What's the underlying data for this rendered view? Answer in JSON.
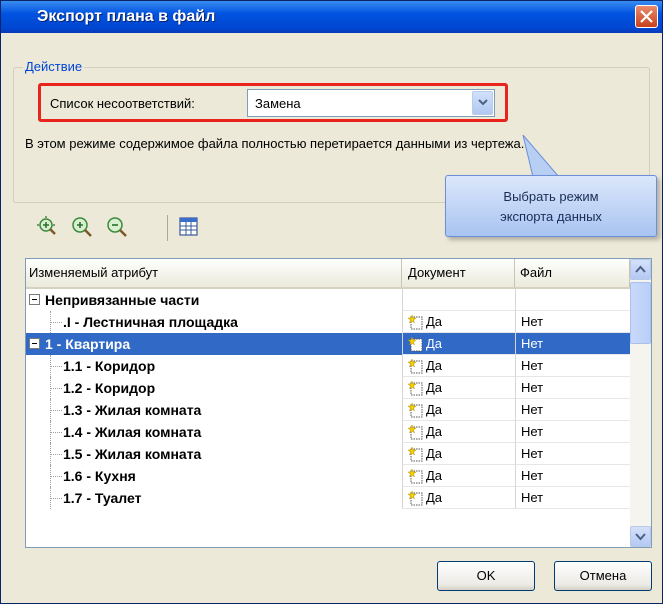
{
  "window": {
    "title": "Экспорт плана в файл"
  },
  "action_group": {
    "legend": "Действие",
    "mismatch_label": "Список несоответствий:",
    "mismatch_value": "Замена",
    "description": "В этом режиме содержимое файла полностью перетирается данными из чертежа."
  },
  "callout": {
    "line1": "Выбрать режим",
    "line2": "экспорта данных"
  },
  "toolbar": {
    "icons": [
      "expand-all-icon",
      "zoom-in-icon",
      "zoom-out-icon",
      "table-icon"
    ]
  },
  "grid": {
    "headers": [
      "Изменяемый атрибут",
      "Документ",
      "Файл"
    ],
    "rows": [
      {
        "name": "Непривязанные части",
        "doc": "",
        "file": "",
        "level": 0,
        "expander": true,
        "selected": false
      },
      {
        "name": ".I - Лестничная площадка",
        "doc": "Да",
        "file": "Нет",
        "level": 1,
        "expander": false,
        "selected": false
      },
      {
        "name": "1 - Квартира",
        "doc": "Да",
        "file": "Нет",
        "level": 0,
        "expander": true,
        "selected": true
      },
      {
        "name": "1.1 - Коридор",
        "doc": "Да",
        "file": "Нет",
        "level": 1,
        "expander": false,
        "selected": false
      },
      {
        "name": "1.2 - Коридор",
        "doc": "Да",
        "file": "Нет",
        "level": 1,
        "expander": false,
        "selected": false
      },
      {
        "name": "1.3 - Жилая комната",
        "doc": "Да",
        "file": "Нет",
        "level": 1,
        "expander": false,
        "selected": false
      },
      {
        "name": "1.4 - Жилая комната",
        "doc": "Да",
        "file": "Нет",
        "level": 1,
        "expander": false,
        "selected": false
      },
      {
        "name": "1.5 - Жилая комната",
        "doc": "Да",
        "file": "Нет",
        "level": 1,
        "expander": false,
        "selected": false
      },
      {
        "name": "1.6 - Кухня",
        "doc": "Да",
        "file": "Нет",
        "level": 1,
        "expander": false,
        "selected": false
      },
      {
        "name": "1.7 - Туалет",
        "doc": "Да",
        "file": "Нет",
        "level": 1,
        "expander": false,
        "selected": false
      }
    ]
  },
  "buttons": {
    "ok": "OK",
    "cancel": "Отмена"
  },
  "colors": {
    "title_bar": "#0053e0",
    "selection": "#3169c6",
    "highlight_frame": "#e8241c",
    "legend_text": "#0046d5"
  }
}
